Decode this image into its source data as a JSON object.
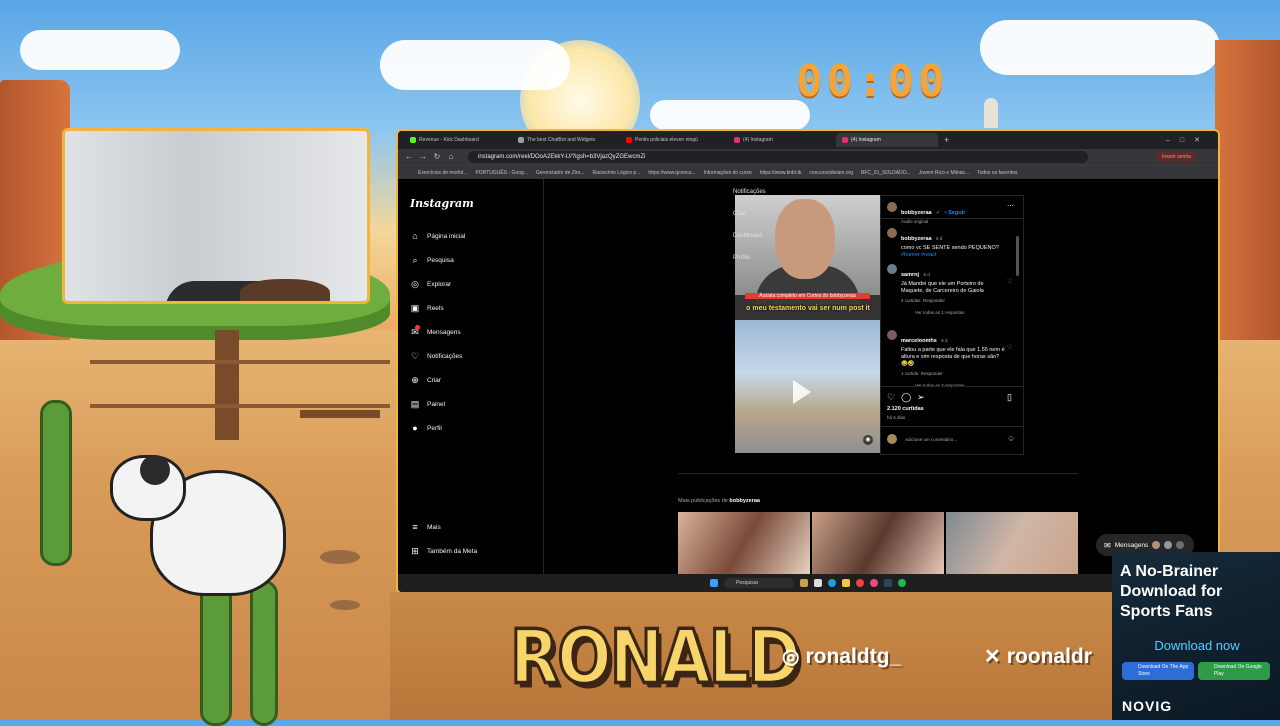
{
  "timer": "00:00",
  "browser": {
    "tabs": [
      {
        "label": "Revenue - Kick Dashboard",
        "color": "#53fc18"
      },
      {
        "label": "The best ChatBot and Widgets",
        "color": "#9aa0a6"
      },
      {
        "label": "Pentis policiais eleven ningú",
        "color": "#ff0000"
      },
      {
        "label": "(4) Instagram",
        "color": "#e1306c"
      },
      {
        "label": "(4) Instagram",
        "color": "#e1306c"
      }
    ],
    "url": "instagram.com/reel/DOoA2EkkY-U/?igsh=b3VjazQyZGEwcmZi",
    "profile_chip": "Inserir senha",
    "bookmarks": [
      "Exercícios de morfol...",
      "PORTUGUÊS - Goog...",
      "Gerenciador de Ziro...",
      "Raciocínio Lógico p...",
      "https://www.qconcu...",
      "Informações do curso",
      "https://www.tinbt.tk",
      "concursoideiam.org",
      "BFC_01_SOLDADO...",
      "Jovem Rico e Milnas...",
      "Todos os favoritos"
    ]
  },
  "instagram": {
    "logo": "Instagram",
    "nav": [
      {
        "label": "Página inicial",
        "icon": "home-icon",
        "glyph": "⌂"
      },
      {
        "label": "Pesquisa",
        "icon": "search-icon",
        "glyph": "⌕"
      },
      {
        "label": "Explorar",
        "icon": "compass-icon",
        "glyph": "◎"
      },
      {
        "label": "Reels",
        "icon": "reels-icon",
        "glyph": "▣"
      },
      {
        "label": "Mensagens",
        "icon": "messenger-icon",
        "glyph": "✉"
      },
      {
        "label": "Notificações",
        "icon": "heart-icon",
        "glyph": "♡"
      },
      {
        "label": "Criar",
        "icon": "plus-icon",
        "glyph": "⊕"
      },
      {
        "label": "Painel",
        "icon": "dashboard-icon",
        "glyph": "▤"
      },
      {
        "label": "Perfil",
        "icon": "profile-avatar",
        "glyph": "●"
      }
    ],
    "nav_bottom": [
      {
        "label": "Mais",
        "icon": "menu-icon",
        "glyph": "≡"
      },
      {
        "label": "Também da Meta",
        "icon": "meta-icon",
        "glyph": "⊞"
      }
    ],
    "reel_menu": [
      "Notificações",
      "Criar",
      "Dashboard",
      "Profile"
    ],
    "reel_banner": "Assista completo em  Cortes do bobbyzeraa",
    "reel_caption": "o meu testamento vai ser num post it",
    "post": {
      "author": "bobbyzeraa",
      "follow": "• Seguir",
      "audio": "Áudio original",
      "caption_author": "bobbyzeraa",
      "caption_time": "6 d",
      "caption": "como vc SE SENTE sendo PEQUENO?",
      "hashtags": "#humor #react",
      "comments": [
        {
          "user": "samrnj",
          "time": "6 d",
          "text": "Já Mandei que ele um Porteiro de Maquete, de Carcereiro de Gaiola",
          "likes": "4 curtidas",
          "reply": "Responder",
          "view": "Ver todas as 1 respostas"
        },
        {
          "user": "marceloomhs",
          "time": "6 d",
          "text": "Faltou a parte que ele fala que 1.55 nem é altura e sim resposta de que horas são? 😂🤣",
          "likes": "1 curtida",
          "reply": "Responder",
          "view": "Ver todas as 2 respostas"
        }
      ],
      "likes": "2.120 curtidas",
      "age": "há 6 dias",
      "comment_placeholder": "Adicione um comentário..."
    },
    "more_posts_prefix": "Mais publicações de ",
    "more_posts_user": "bobbyzeraa",
    "messages_pill": "Mensagens"
  },
  "taskbar": {
    "search": "Pesquisar"
  },
  "ad": {
    "title": "A No-Brainer Download for Sports Fans",
    "cta": "Download now",
    "app_store": "Download On The App Store",
    "google_play": "Download On Google Play",
    "brand": "NOVIG"
  },
  "banner": {
    "name": "RONALD",
    "instagram": "ronaldtg_",
    "x": "roonaldr"
  }
}
